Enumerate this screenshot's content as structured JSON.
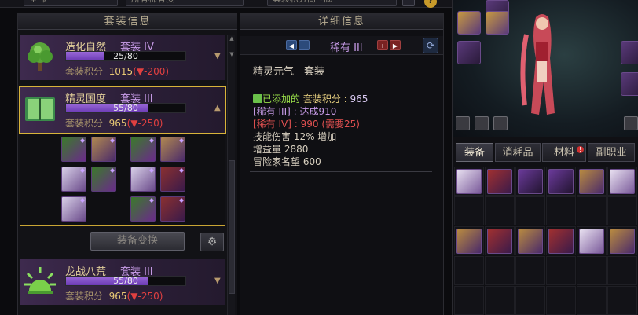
{
  "top": {
    "field1": "全部",
    "field2": "所有稀有度",
    "field3": "套装积分高→低"
  },
  "left": {
    "header": "套装信息",
    "sets": [
      {
        "name": "造化自然",
        "tier": "套装 IV",
        "progress": "25/80",
        "progress_value": 25,
        "progress_max": 80,
        "score_label": "套装积分",
        "score": "1015",
        "delta_open": "(",
        "delta_arrow": "▼",
        "delta": "-200",
        "delta_close": ")",
        "icon": "tree-icon",
        "expanded": false
      },
      {
        "name": "精灵国度",
        "tier": "套装 III",
        "progress": "55/80",
        "progress_value": 55,
        "progress_max": 80,
        "score_label": "套装积分",
        "score": "965",
        "delta_open": "(",
        "delta_arrow": "▼",
        "delta": "-250",
        "delta_close": ")",
        "icon": "book-icon",
        "expanded": true
      },
      {
        "name": "龙战八荒",
        "tier": "套装 III",
        "progress": "55/80",
        "progress_value": 55,
        "progress_max": 80,
        "score_label": "套装积分",
        "score": "965",
        "delta_open": "(",
        "delta_arrow": "▼",
        "delta": "-250",
        "delta_close": ")",
        "icon": "sun-icon",
        "expanded": false
      }
    ],
    "change_button": "装备变换",
    "wrench_icon": "wrench-icon"
  },
  "middle": {
    "header": "详细信息",
    "tier_name": "稀有 III",
    "set_title": "精灵元气　套装",
    "added_prefix": "已添加的",
    "added_label": "套装积分 : ",
    "added_value": "965",
    "line1": "[稀有 III] : 达成910",
    "line2": "[稀有 IV] : 990 (需要25)",
    "line3": "技能伤害 12% 增加",
    "line4": "增益量 2880",
    "line5": "冒险家名望 600"
  },
  "right": {
    "tabs": [
      "装备",
      "消耗品",
      "材料",
      "副职业"
    ],
    "active_tab": 0,
    "materials_badge": "!"
  },
  "colors": {
    "accent_gold": "#d8b43a",
    "rare_purple": "#c89ce8",
    "deficit_red": "#e04040",
    "added_green": "#9ae04a"
  }
}
